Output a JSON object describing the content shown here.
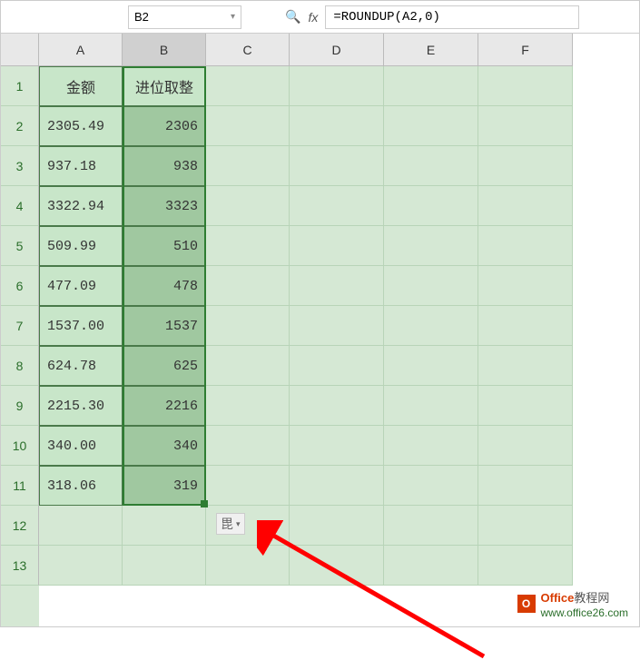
{
  "nameBox": "B2",
  "formula": "=ROUNDUP(A2,0)",
  "columns": [
    "A",
    "B",
    "C",
    "D",
    "E",
    "F"
  ],
  "rowNumbers": [
    "1",
    "2",
    "3",
    "4",
    "5",
    "6",
    "7",
    "8",
    "9",
    "10",
    "11",
    "12",
    "13"
  ],
  "headers": {
    "A": "金额",
    "B": "进位取整"
  },
  "chart_data": {
    "type": "table",
    "columns": [
      "金额",
      "进位取整"
    ],
    "data": [
      {
        "A": "2305.49",
        "B": "2306"
      },
      {
        "A": "937.18",
        "B": "938"
      },
      {
        "A": "3322.94",
        "B": "3323"
      },
      {
        "A": "509.99",
        "B": "510"
      },
      {
        "A": "477.09",
        "B": "478"
      },
      {
        "A": "1537.00",
        "B": "1537"
      },
      {
        "A": "624.78",
        "B": "625"
      },
      {
        "A": "2215.30",
        "B": "2216"
      },
      {
        "A": "340.00",
        "B": "340"
      },
      {
        "A": "318.06",
        "B": "319"
      }
    ]
  },
  "autofillIcon": "毘",
  "watermark": {
    "brand1": "Office",
    "brand2": "教程网",
    "url": "www.office26.com"
  }
}
